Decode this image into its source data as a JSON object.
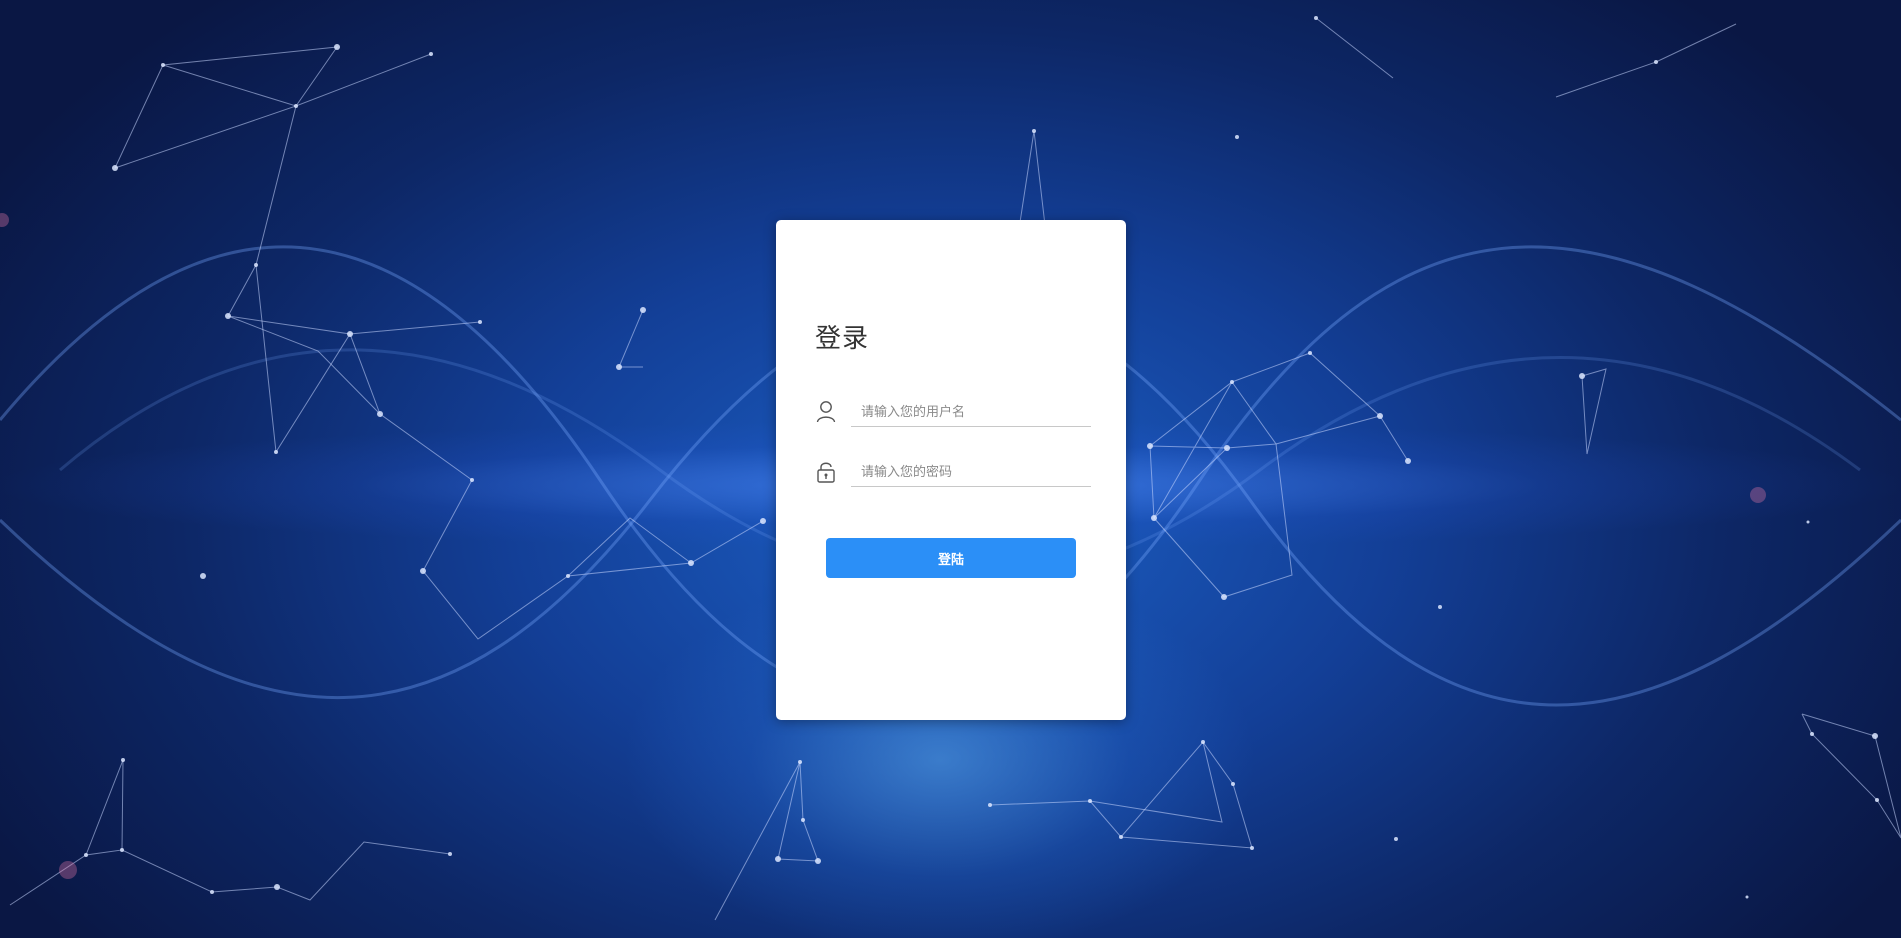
{
  "login": {
    "title": "登录",
    "username": {
      "placeholder": "请输入您的用户名",
      "value": "",
      "icon": "user-icon"
    },
    "password": {
      "placeholder": "请输入您的密码",
      "value": "",
      "icon": "lock-icon"
    },
    "submit_label": "登陆"
  },
  "colors": {
    "accent": "#2b8ff7",
    "card": "#ffffff",
    "background": "#133f97"
  }
}
